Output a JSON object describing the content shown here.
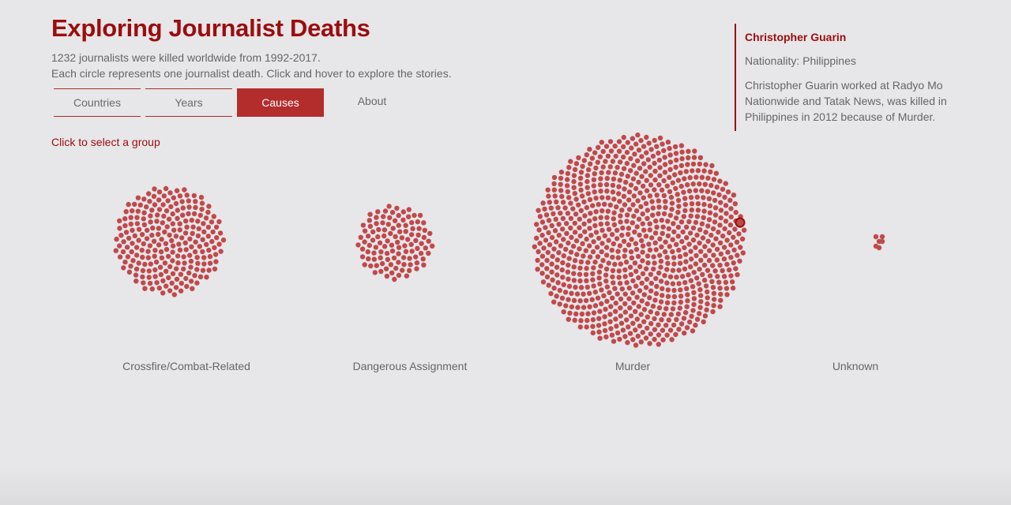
{
  "header": {
    "title": "Exploring Journalist Deaths",
    "description_line1": "1232 journalists were killed worldwide from 1992-2017.",
    "description_line2": "Each circle represents one journalist death. Click and hover to explore the stories."
  },
  "tabs": [
    {
      "label": "Countries",
      "active": false
    },
    {
      "label": "Years",
      "active": false
    },
    {
      "label": "Causes",
      "active": true
    },
    {
      "label": "About",
      "active": false
    }
  ],
  "select_hint": "Click to select a group",
  "info_panel": {
    "name": "Christopher Guarin",
    "nationality": "Nationality: Philippines",
    "story": "Christopher Guarin worked at Radyo Mo Nationwide and Tatak News, was killed in Philippines in 2012 because of Murder."
  },
  "colors": {
    "accent": "#9b0d0d",
    "tab_active": "#b32d2d",
    "dot": "#c0494b",
    "background": "#e7e6e9"
  },
  "chart_data": {
    "type": "packed-dots",
    "groups": [
      {
        "name": "Crossfire/Combat-Related",
        "count": 234
      },
      {
        "name": "Dangerous Assignment",
        "count": 112
      },
      {
        "name": "Murder",
        "count": 880
      },
      {
        "name": "Unknown",
        "count": 6
      }
    ],
    "highlighted": {
      "group": "Murder",
      "person": "Christopher Guarin"
    }
  }
}
